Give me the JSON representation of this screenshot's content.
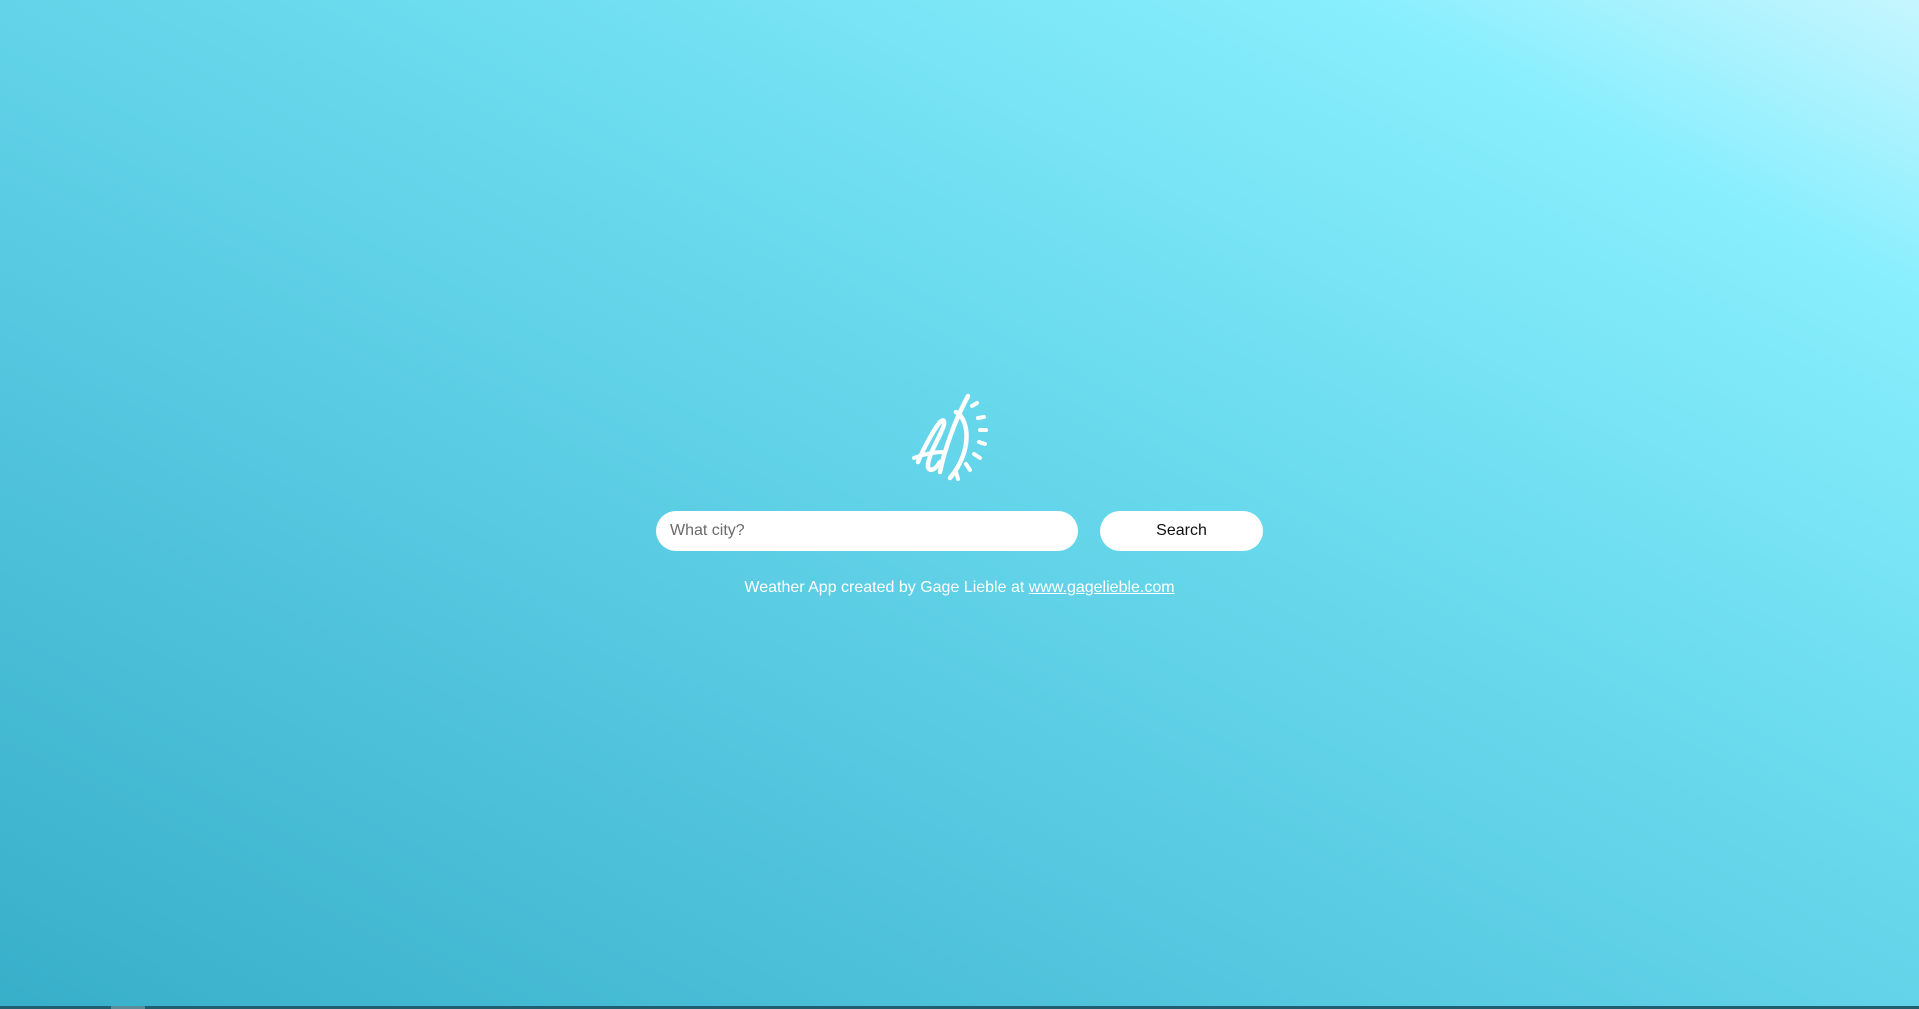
{
  "logo": {
    "icon": "signature-sun-logo"
  },
  "search": {
    "placeholder": "What city?",
    "value": "",
    "button_label": "Search"
  },
  "footer": {
    "credit_text": "Weather App created by Gage Lieble at ",
    "link_text": "www.gagelieble.com"
  },
  "colors": {
    "gradient_start": "#38afca",
    "gradient_end": "#c6f6ff",
    "input_bg": "#ffffff",
    "text_white": "#ffffff"
  }
}
